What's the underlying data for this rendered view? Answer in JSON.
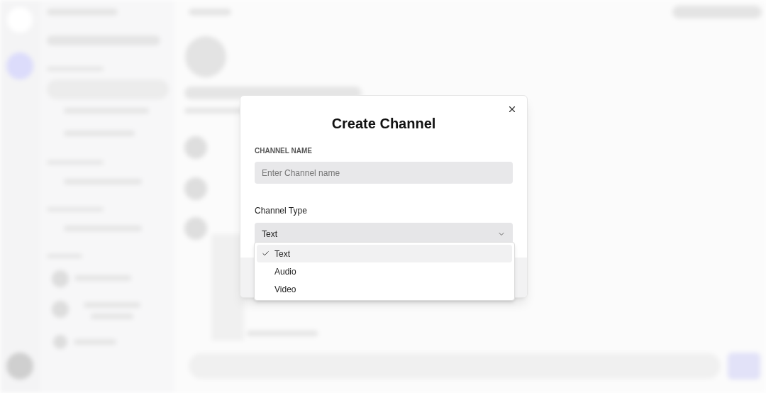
{
  "dialog": {
    "title": "Create Channel",
    "name_field": {
      "label": "CHANNEL NAME",
      "placeholder": "Enter Channel name"
    },
    "type_field": {
      "label": "Channel Type",
      "value": "Text",
      "expanded": true,
      "options": [
        {
          "label": "Text",
          "selected": true
        },
        {
          "label": "Audio",
          "selected": false
        },
        {
          "label": "Video",
          "selected": false
        }
      ]
    }
  }
}
